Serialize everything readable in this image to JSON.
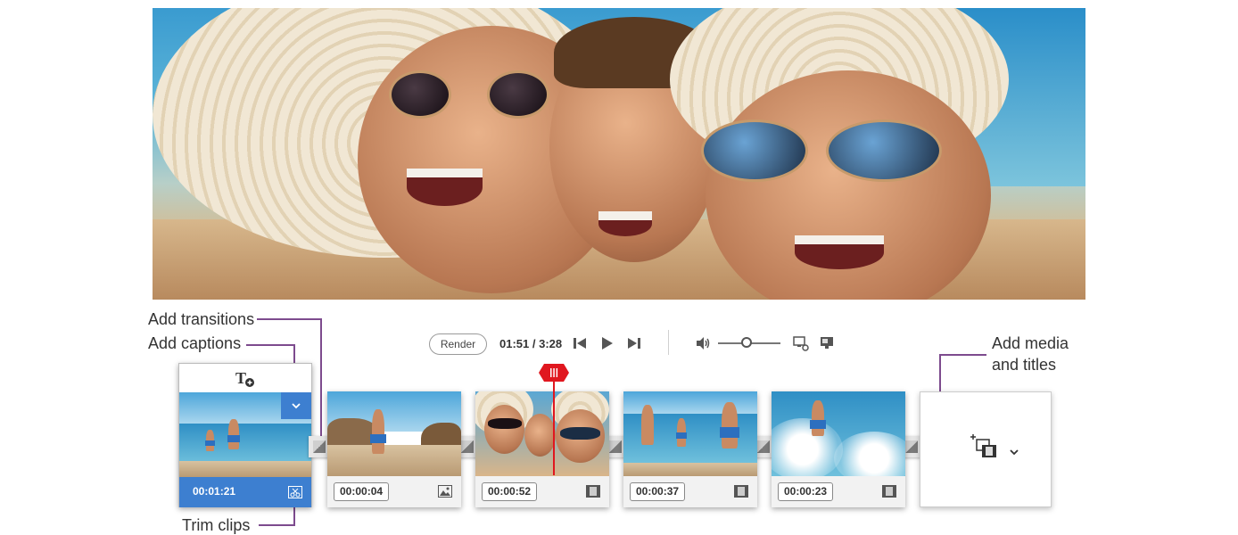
{
  "callouts": {
    "transitions": "Add transitions",
    "captions": "Add captions",
    "trim": "Trim clips",
    "media_line1": "Add media",
    "media_line2": "and titles"
  },
  "toolbar": {
    "render_label": "Render",
    "timecode": "01:51 / 3:28",
    "volume_level": 0.45
  },
  "timeline": {
    "selected_clip": {
      "duration": "00:01:21",
      "type": "video"
    },
    "clips": [
      {
        "duration": "00:00:04",
        "type": "image"
      },
      {
        "duration": "00:00:52",
        "type": "video"
      },
      {
        "duration": "00:00:37",
        "type": "video"
      },
      {
        "duration": "00:00:23",
        "type": "video"
      }
    ]
  },
  "colors": {
    "accent_blue": "#3d7fd0",
    "playhead_red": "#e0171f",
    "callout_line": "#7d4b8e"
  },
  "icons": {
    "caption": "text-add-icon",
    "prev": "step-back-icon",
    "play": "play-icon",
    "next": "step-forward-icon",
    "volume": "speaker-icon",
    "display1": "monitor-settings-icon",
    "display2": "monitor-icon",
    "trim": "scissors-icon",
    "add_media": "add-media-icon"
  }
}
